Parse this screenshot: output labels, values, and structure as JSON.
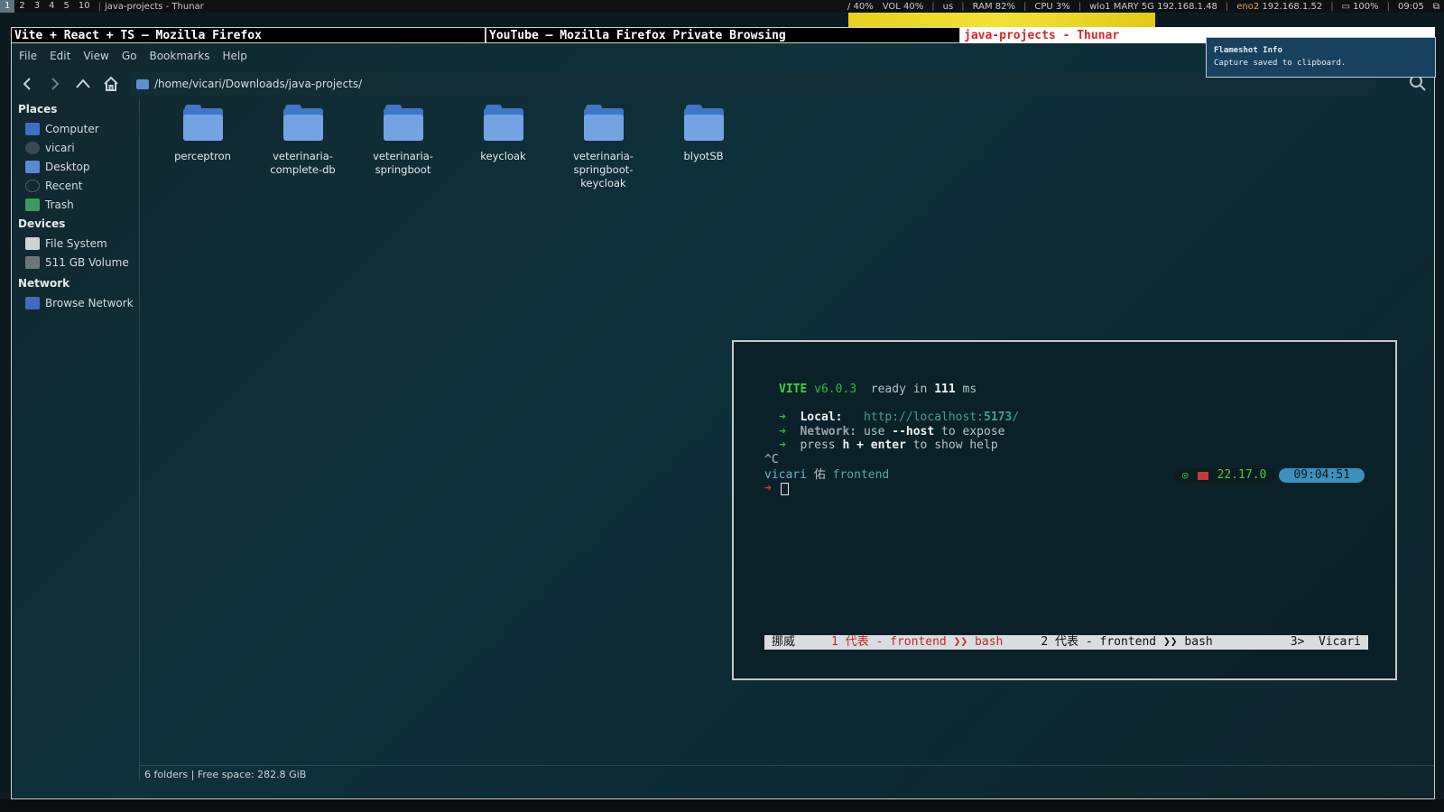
{
  "topbar": {
    "workspaces": [
      "1",
      "2",
      "3",
      "4",
      "5",
      "10"
    ],
    "active_workspace": "1",
    "window_title": "java-projects - Thunar",
    "status": {
      "brightness": "/ 40%",
      "volume": "VOL 40%",
      "layout": "us",
      "ram": "RAM 82%",
      "cpu": "CPU  3%",
      "wifi": "wlo1 MARY 5G 192.168.1.48",
      "eth_iface": "eno2",
      "eth_ip": "192.168.1.52",
      "battery": "100%",
      "clock": "09:05"
    }
  },
  "tabs": [
    "Vite + React + TS — Mozilla Firefox",
    "YouTube — Mozilla Firefox Private Browsing",
    "java-projects - Thunar"
  ],
  "thunar": {
    "menu": [
      "File",
      "Edit",
      "View",
      "Go",
      "Bookmarks",
      "Help"
    ],
    "path": "/home/vicari/Downloads/java-projects/",
    "sidebar": {
      "places_title": "Places",
      "places": [
        "Computer",
        "vicari",
        "Desktop",
        "Recent",
        "Trash"
      ],
      "devices_title": "Devices",
      "devices": [
        "File System",
        "511 GB Volume"
      ],
      "network_title": "Network",
      "network": [
        "Browse Network"
      ]
    },
    "folders": [
      {
        "l1": "perceptron",
        "l2": ""
      },
      {
        "l1": "veterinaria-",
        "l2": "complete-db"
      },
      {
        "l1": "veterinaria-",
        "l2": "springboot"
      },
      {
        "l1": "keycloak",
        "l2": ""
      },
      {
        "l1": "veterinaria-",
        "l2": "springboot-keycloak"
      },
      {
        "l1": "blyotSB",
        "l2": ""
      }
    ],
    "status": "6 folders  |  Free space: 282.8 GiB"
  },
  "terminal": {
    "vite_name": "VITE",
    "vite_version": "v6.0.3",
    "ready_text": "ready in",
    "ready_ms": "111",
    "ms": "ms",
    "arrow": "➜",
    "local_label": "Local:",
    "local_url_base": "http://localhost:",
    "local_url_port": "5173",
    "local_url_tail": "/",
    "network_label": "Network:",
    "network_use": "use",
    "network_flag": "--host",
    "network_tail": "to expose",
    "press": "press",
    "help_keys": "h + enter",
    "help_tail": "to show help",
    "interrupt": "^C",
    "prompt_user": "vicari",
    "prompt_glyph": "佑",
    "prompt_dir": "frontend",
    "prompt_arrow": "➜",
    "node_version": "22.17.0",
    "node_dot": "◎",
    "time": "09:04:51",
    "tmux_session": "挪威",
    "tmux_win1": "1 代表 - frontend ❯❯ bash",
    "tmux_win2": "2 代表 - frontend ❯❯ bash",
    "tmux_right": "3>  Vicari"
  },
  "notification": {
    "title": "Flameshot Info",
    "body": "Capture saved to clipboard."
  }
}
